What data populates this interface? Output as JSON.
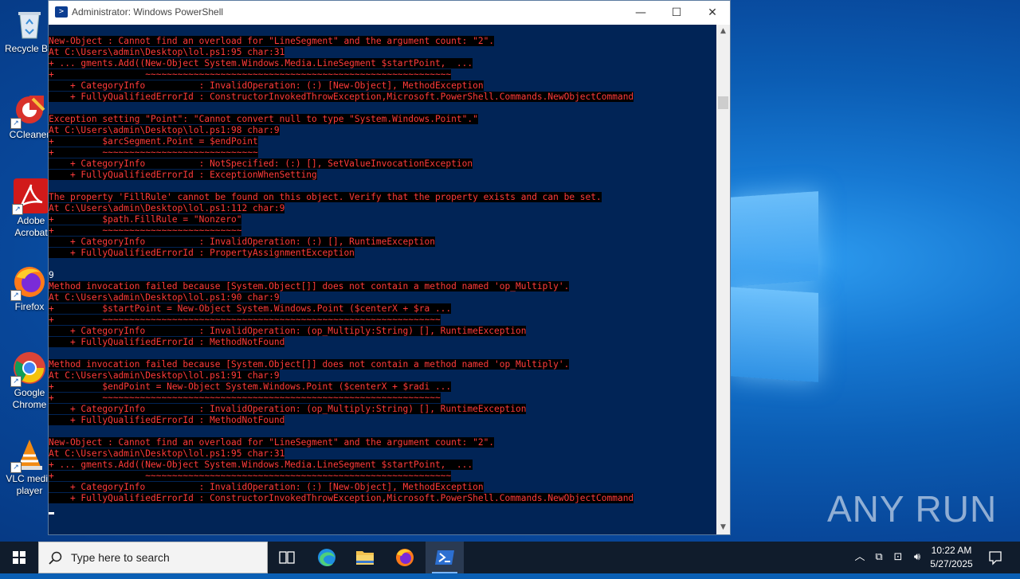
{
  "window": {
    "title": "Administrator: Windows PowerShell",
    "controls": {
      "minimize": "—",
      "maximize": "☐",
      "close": "✕"
    }
  },
  "console_lines": [
    {
      "text": "New-Object : Cannot find an overload for \"LineSegment\" and the argument count: \"2\".",
      "style": "err"
    },
    {
      "text": "At C:\\Users\\admin\\Desktop\\lol.ps1:95 char:31",
      "style": "err"
    },
    {
      "text": "+ ... gments.Add((New-Object System.Windows.Media.LineSegment $startPoint,  ...",
      "style": "err"
    },
    {
      "text": "+                 ~~~~~~~~~~~~~~~~~~~~~~~~~~~~~~~~~~~~~~~~~~~~~~~~~~~~~~~~~",
      "style": "err"
    },
    {
      "text": "    + CategoryInfo          : InvalidOperation: (:) [New-Object], MethodException",
      "style": "err"
    },
    {
      "text": "    + FullyQualifiedErrorId : ConstructorInvokedThrowException,Microsoft.PowerShell.Commands.NewObjectCommand",
      "style": "err"
    },
    {
      "text": "",
      "style": "plain"
    },
    {
      "text": "Exception setting \"Point\": \"Cannot convert null to type \"System.Windows.Point\".\"",
      "style": "err"
    },
    {
      "text": "At C:\\Users\\admin\\Desktop\\lol.ps1:98 char:9",
      "style": "err"
    },
    {
      "text": "+         $arcSegment.Point = $endPoint",
      "style": "err"
    },
    {
      "text": "+         ~~~~~~~~~~~~~~~~~~~~~~~~~~~~~",
      "style": "err"
    },
    {
      "text": "    + CategoryInfo          : NotSpecified: (:) [], SetValueInvocationException",
      "style": "err"
    },
    {
      "text": "    + FullyQualifiedErrorId : ExceptionWhenSetting",
      "style": "err"
    },
    {
      "text": "",
      "style": "plain"
    },
    {
      "text": "The property 'FillRule' cannot be found on this object. Verify that the property exists and can be set.",
      "style": "err"
    },
    {
      "text": "At C:\\Users\\admin\\Desktop\\lol.ps1:112 char:9",
      "style": "err"
    },
    {
      "text": "+         $path.FillRule = \"Nonzero\"",
      "style": "err"
    },
    {
      "text": "+         ~~~~~~~~~~~~~~~~~~~~~~~~~~",
      "style": "err"
    },
    {
      "text": "    + CategoryInfo          : InvalidOperation: (:) [], RuntimeException",
      "style": "err"
    },
    {
      "text": "    + FullyQualifiedErrorId : PropertyAssignmentException",
      "style": "err"
    },
    {
      "text": "",
      "style": "plain"
    },
    {
      "text": "9",
      "style": "plain"
    },
    {
      "text": "Method invocation failed because [System.Object[]] does not contain a method named 'op_Multiply'.",
      "style": "err"
    },
    {
      "text": "At C:\\Users\\admin\\Desktop\\lol.ps1:90 char:9",
      "style": "err"
    },
    {
      "text": "+         $startPoint = New-Object System.Windows.Point ($centerX + $ra ...",
      "style": "err"
    },
    {
      "text": "+         ~~~~~~~~~~~~~~~~~~~~~~~~~~~~~~~~~~~~~~~~~~~~~~~~~~~~~~~~~~~~~~~",
      "style": "err"
    },
    {
      "text": "    + CategoryInfo          : InvalidOperation: (op_Multiply:String) [], RuntimeException",
      "style": "err"
    },
    {
      "text": "    + FullyQualifiedErrorId : MethodNotFound",
      "style": "err"
    },
    {
      "text": "",
      "style": "plain"
    },
    {
      "text": "Method invocation failed because [System.Object[]] does not contain a method named 'op_Multiply'.",
      "style": "err"
    },
    {
      "text": "At C:\\Users\\admin\\Desktop\\lol.ps1:91 char:9",
      "style": "err"
    },
    {
      "text": "+         $endPoint = New-Object System.Windows.Point ($centerX + $radi ...",
      "style": "err"
    },
    {
      "text": "+         ~~~~~~~~~~~~~~~~~~~~~~~~~~~~~~~~~~~~~~~~~~~~~~~~~~~~~~~~~~~~~~~",
      "style": "err"
    },
    {
      "text": "    + CategoryInfo          : InvalidOperation: (op_Multiply:String) [], RuntimeException",
      "style": "err"
    },
    {
      "text": "    + FullyQualifiedErrorId : MethodNotFound",
      "style": "err"
    },
    {
      "text": "",
      "style": "plain"
    },
    {
      "text": "New-Object : Cannot find an overload for \"LineSegment\" and the argument count: \"2\".",
      "style": "err"
    },
    {
      "text": "At C:\\Users\\admin\\Desktop\\lol.ps1:95 char:31",
      "style": "err"
    },
    {
      "text": "+ ... gments.Add((New-Object System.Windows.Media.LineSegment $startPoint,  ...",
      "style": "err"
    },
    {
      "text": "+                 ~~~~~~~~~~~~~~~~~~~~~~~~~~~~~~~~~~~~~~~~~~~~~~~~~~~~~~~~~",
      "style": "err"
    },
    {
      "text": "    + CategoryInfo          : InvalidOperation: (:) [New-Object], MethodException",
      "style": "err"
    },
    {
      "text": "    + FullyQualifiedErrorId : ConstructorInvokedThrowException,Microsoft.PowerShell.Commands.NewObjectCommand",
      "style": "err"
    }
  ],
  "desktop_icons": [
    {
      "label": "Recycle Bin",
      "icon": "recycle-bin-icon"
    },
    {
      "label": "CCleaner",
      "icon": "ccleaner-icon"
    },
    {
      "label": "Adobe Acrobat",
      "icon": "adobe-acrobat-icon"
    },
    {
      "label": "Firefox",
      "icon": "firefox-icon"
    },
    {
      "label": "Google Chrome",
      "icon": "chrome-icon"
    },
    {
      "label": "VLC media player",
      "icon": "vlc-icon"
    }
  ],
  "taskbar": {
    "search_placeholder": "Type here to search",
    "clock_time": "10:22 AM",
    "clock_date": "5/27/2025"
  },
  "watermark": "ANY RUN",
  "colors": {
    "console_bg": "#012456",
    "error_fg": "#ff3b3b",
    "taskbar_bg": "#101c2c"
  }
}
